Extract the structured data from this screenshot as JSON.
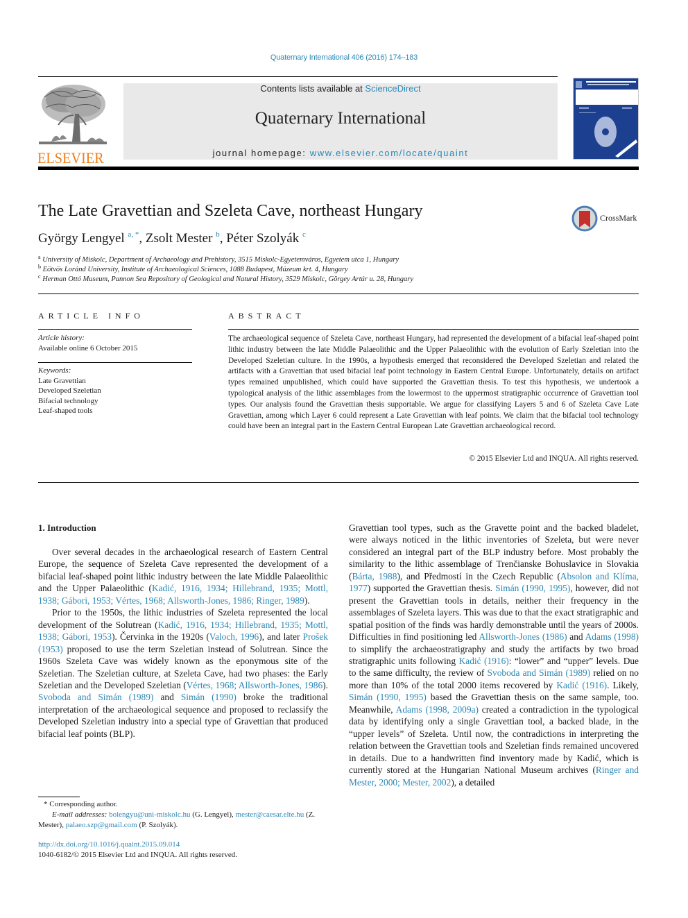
{
  "header": {
    "citation": "Quaternary International 406 (2016) 174–183",
    "contents_prefix": "Contents lists available at ",
    "contents_link": "ScienceDirect",
    "journal_title": "Quaternary International",
    "homepage_prefix": "journal homepage: ",
    "homepage_link": "www.elsevier.com/locate/quaint",
    "publisher_logo_text": "ELSEVIER",
    "crossmark_label": "CrossMark"
  },
  "colors": {
    "link": "#2b87b5",
    "elsevier_orange": "#f07d1a",
    "cover_blue": "#1d3f8f",
    "banner_gray": "#e9e9e9"
  },
  "article": {
    "title": "The Late Gravettian and Szeleta Cave, northeast Hungary",
    "authors": [
      {
        "name": "György Lengyel",
        "sup": "a, *"
      },
      {
        "name": "Zsolt Mester",
        "sup": "b"
      },
      {
        "name": "Péter Szolyák",
        "sup": "c"
      }
    ],
    "affiliations": [
      {
        "sup": "a",
        "text": "University of Miskolc, Department of Archaeology and Prehistory, 3515 Miskolc-Egyetemváros, Egyetem utca 1, Hungary"
      },
      {
        "sup": "b",
        "text": "Eötvös Loránd University, Institute of Archaeological Sciences, 1088 Budapest, Múzeum krt. 4, Hungary"
      },
      {
        "sup": "c",
        "text": "Herman Ottó Museum, Pannon Sea Repository of Geological and Natural History, 3529 Miskolc, Görgey Artúr u. 28, Hungary"
      }
    ]
  },
  "article_info": {
    "heading": "ARTICLE INFO",
    "history_label": "Article history:",
    "history_value": "Available online 6 October 2015",
    "keywords_label": "Keywords:",
    "keywords": [
      "Late Gravettian",
      "Developed Szeletian",
      "Bifacial technology",
      "Leaf-shaped tools"
    ]
  },
  "abstract": {
    "heading": "ABSTRACT",
    "text": "The archaeological sequence of Szeleta Cave, northeast Hungary, had represented the development of a bifacial leaf-shaped point lithic industry between the late Middle Palaeolithic and the Upper Palaeolithic with the evolution of Early Szeletian into the Developed Szeletian culture. In the 1990s, a hypothesis emerged that reconsidered the Developed Szeletian and related the artifacts with a Gravettian that used bifacial leaf point technology in Eastern Central Europe. Unfortunately, details on artifact types remained unpublished, which could have supported the Gravettian thesis. To test this hypothesis, we undertook a typological analysis of the lithic assemblages from the lowermost to the uppermost stratigraphic occurrence of Gravettian tool types. Our analysis found the Gravettian thesis supportable. We argue for classifying Layers 5 and 6 of Szeleta Cave Late Gravettian, among which Layer 6 could represent a Late Gravettian with leaf points. We claim that the bifacial tool technology could have been an integral part in the Eastern Central European Late Gravettian archaeological record.",
    "copyright": "© 2015 Elsevier Ltd and INQUA. All rights reserved."
  },
  "body": {
    "section_heading": "1.  Introduction",
    "col1_p1": [
      {
        "t": "Over several decades in the archaeological research of Eastern Central Europe, the sequence of Szeleta Cave represented the development of a bifacial leaf-shaped point lithic industry between the late Middle Palaeolithic and the Upper Palaeolithic ("
      },
      {
        "l": "Kadić, 1916, 1934; Hillebrand, 1935; Mottl, 1938; Gábori, 1953; Vértes, 1968; Allsworth-Jones, 1986; Ringer, 1989"
      },
      {
        "t": ")."
      }
    ],
    "col1_p2": [
      {
        "t": "Prior to the 1950s, the lithic industries of Szeleta represented the local development of the Solutrean ("
      },
      {
        "l": "Kadić, 1916, 1934; Hillebrand, 1935; Mottl, 1938; Gábori, 1953"
      },
      {
        "t": "). Červinka in the 1920s ("
      },
      {
        "l": "Valoch, 1996"
      },
      {
        "t": "), and later "
      },
      {
        "l": "Prošek (1953)"
      },
      {
        "t": " proposed to use the term Szeletian instead of Solutrean. Since the 1960s Szeleta Cave was widely known as the eponymous site of the Szeletian. The Szeletian culture, at Szeleta Cave, had two phases: the Early Szeletian and the Developed Szeletian ("
      },
      {
        "l": "Vértes, 1968; Allsworth-Jones, 1986"
      },
      {
        "t": "). "
      },
      {
        "l": "Svoboda and Simán (1989)"
      },
      {
        "t": " and "
      },
      {
        "l": "Simán (1990)"
      },
      {
        "t": " broke the traditional interpretation of the archaeological sequence and proposed to reclassify the Developed Szeletian industry into a special type of Gravettian that produced bifacial leaf points (BLP)."
      }
    ],
    "col2_p1": [
      {
        "t": "Gravettian tool types, such as the Gravette point and the backed bladelet, were always noticed in the lithic inventories of Szeleta, but were never considered an integral part of the BLP industry before. Most probably the similarity to the lithic assemblage of Trenčianske Bohuslavice in Slovakia ("
      },
      {
        "l": "Bárta, 1988"
      },
      {
        "t": "), and Předmostí in the Czech Republic ("
      },
      {
        "l": "Absolon and Klíma, 1977"
      },
      {
        "t": ") supported the Gravettian thesis. "
      },
      {
        "l": "Simán (1990, 1995)"
      },
      {
        "t": ", however, did not present the Gravettian tools in details, neither their frequency in the assemblages of Szeleta layers. This was due to that the exact stratigraphic and spatial position of the finds was hardly demonstrable until the years of 2000s. Difficulties in find positioning led "
      },
      {
        "l": "Allsworth-Jones (1986)"
      },
      {
        "t": " and "
      },
      {
        "l": "Adams (1998)"
      },
      {
        "t": " to simplify the archaeostratigraphy and study the artifacts by two broad stratigraphic units following "
      },
      {
        "l": "Kadić (1916)"
      },
      {
        "t": ": “lower” and “upper” levels. Due to the same difficulty, the review of "
      },
      {
        "l": "Svoboda and Simán (1989)"
      },
      {
        "t": " relied on no more than 10% of the total 2000 items recovered by "
      },
      {
        "l": "Kadić (1916)"
      },
      {
        "t": ". Likely, "
      },
      {
        "l": "Simán (1990, 1995)"
      },
      {
        "t": " based the Gravettian thesis on the same sample, too. Meanwhile, "
      },
      {
        "l": "Adams (1998, 2009a)"
      },
      {
        "t": " created a contradiction in the typological data by identifying only a single Gravettian tool, a backed blade, in the “upper levels” of Szeleta. Until now, the contradictions in interpreting the relation between the Gravettian tools and Szeletian finds remained uncovered in details. Due to a handwritten find inventory made by Kadić, which is currently stored at the Hungarian National Museum archives ("
      },
      {
        "l": "Ringer and Mester, 2000; Mester, 2002"
      },
      {
        "t": "), a detailed"
      }
    ]
  },
  "footnote": {
    "corresponding": "*  Corresponding author.",
    "email_label": "E-mail addresses: ",
    "emails": [
      {
        "addr": "bolengyu@uni-miskolc.hu",
        "who": " (G. Lengyel), "
      },
      {
        "addr": "mester@caesar.elte.hu",
        "who": " (Z. Mester), "
      },
      {
        "addr": "palaeo.szp@gmail.com",
        "who": " (P. Szolyák)."
      }
    ],
    "doi": "http://dx.doi.org/10.1016/j.quaint.2015.09.014",
    "issn_copyright": "1040-6182/© 2015 Elsevier Ltd and INQUA. All rights reserved."
  }
}
